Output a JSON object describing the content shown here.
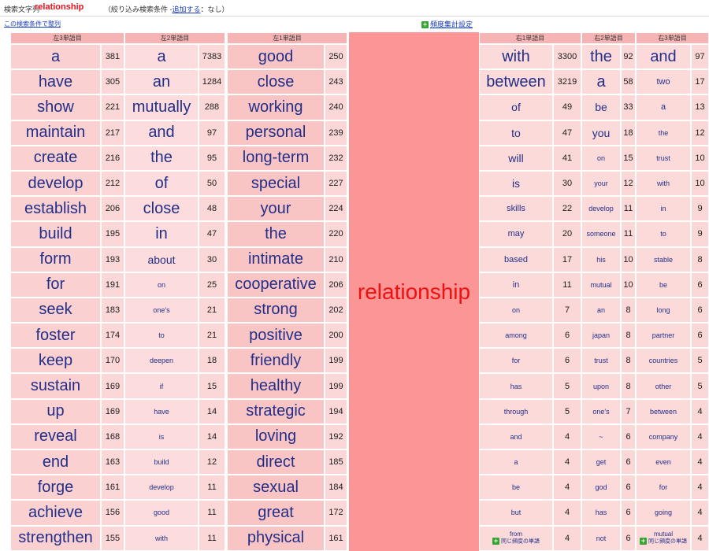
{
  "search": {
    "label": "検索文字列",
    "keyword": "relationship",
    "filter_prefix": "（絞り込み検索条件 -",
    "filter_add": "追加する",
    "filter_suffix": "：なし）",
    "sort_link": "この検索条件で整列"
  },
  "settings": {
    "frequency_label": "頻度集計設定",
    "icon": "plus-icon"
  },
  "center_word": "relationship",
  "colors": {
    "keyword": "#e8141e",
    "center_bg": "#fc9696",
    "word_text": "#222f88",
    "link": "#1a3fb8"
  },
  "columns": [
    {
      "header": "左3単語目",
      "words": [
        "a",
        "have",
        "show",
        "maintain",
        "create",
        "develop",
        "establish",
        "build",
        "form",
        "for",
        "seek",
        "foster",
        "keep",
        "sustain",
        "up",
        "reveal",
        "end",
        "forge",
        "achieve",
        "strengthen"
      ],
      "counts": [
        "381",
        "305",
        "221",
        "217",
        "216",
        "212",
        "206",
        "195",
        "193",
        "191",
        "183",
        "174",
        "170",
        "169",
        "169",
        "168",
        "163",
        "161",
        "156",
        "155"
      ]
    },
    {
      "header": "左2単語目",
      "words": [
        "a",
        "an",
        "mutually",
        "and",
        "the",
        "of",
        "close",
        "in",
        "about",
        "on",
        "one's",
        "to",
        "deepen",
        "if",
        "have",
        "is",
        "build",
        "develop",
        "good",
        "with"
      ],
      "counts": [
        "7383",
        "1284",
        "288",
        "97",
        "95",
        "50",
        "48",
        "47",
        "30",
        "25",
        "21",
        "21",
        "18",
        "15",
        "14",
        "14",
        "12",
        "11",
        "11",
        "11"
      ]
    },
    {
      "header": "左1単語目",
      "words": [
        "good",
        "close",
        "working",
        "personal",
        "long-term",
        "special",
        "your",
        "the",
        "intimate",
        "cooperative",
        "strong",
        "positive",
        "friendly",
        "healthy",
        "strategic",
        "loving",
        "direct",
        "sexual",
        "great",
        "physical"
      ],
      "counts": [
        "250",
        "243",
        "240",
        "239",
        "232",
        "227",
        "224",
        "220",
        "210",
        "206",
        "202",
        "200",
        "199",
        "199",
        "194",
        "192",
        "185",
        "184",
        "172",
        "161"
      ]
    },
    {
      "header": "右1単語目",
      "words": [
        "with",
        "between",
        "of",
        "to",
        "will",
        "is",
        "skills",
        "may",
        "based",
        "in",
        "on",
        "among",
        "for",
        "has",
        "through",
        "and",
        "a",
        "be",
        "but",
        "from"
      ],
      "counts": [
        "3300",
        "3219",
        "49",
        "47",
        "41",
        "30",
        "22",
        "20",
        "17",
        "11",
        "7",
        "6",
        "6",
        "5",
        "5",
        "4",
        "4",
        "4",
        "4",
        "4"
      ],
      "same_freq_note": "同じ頻度の単語"
    },
    {
      "header": "右2単語目",
      "words": [
        "the",
        "a",
        "be",
        "you",
        "on",
        "your",
        "develop",
        "someone",
        "his",
        "mutual",
        "an",
        "japan",
        "trust",
        "upon",
        "one's",
        "~",
        "get",
        "god",
        "has",
        "not"
      ],
      "counts": [
        "92",
        "58",
        "33",
        "18",
        "15",
        "12",
        "11",
        "11",
        "10",
        "10",
        "8",
        "8",
        "8",
        "8",
        "7",
        "6",
        "6",
        "6",
        "6",
        "6"
      ]
    },
    {
      "header": "右3単語目",
      "words": [
        "and",
        "two",
        "a",
        "the",
        "trust",
        "with",
        "in",
        "to",
        "stable",
        "be",
        "long",
        "partner",
        "countries",
        "other",
        "between",
        "company",
        "even",
        "for",
        "going",
        "mutual"
      ],
      "counts": [
        "97",
        "17",
        "13",
        "12",
        "10",
        "10",
        "9",
        "9",
        "8",
        "6",
        "6",
        "6",
        "5",
        "5",
        "4",
        "4",
        "4",
        "4",
        "4",
        "4"
      ],
      "same_freq_note": "同じ頻度の単語"
    }
  ]
}
